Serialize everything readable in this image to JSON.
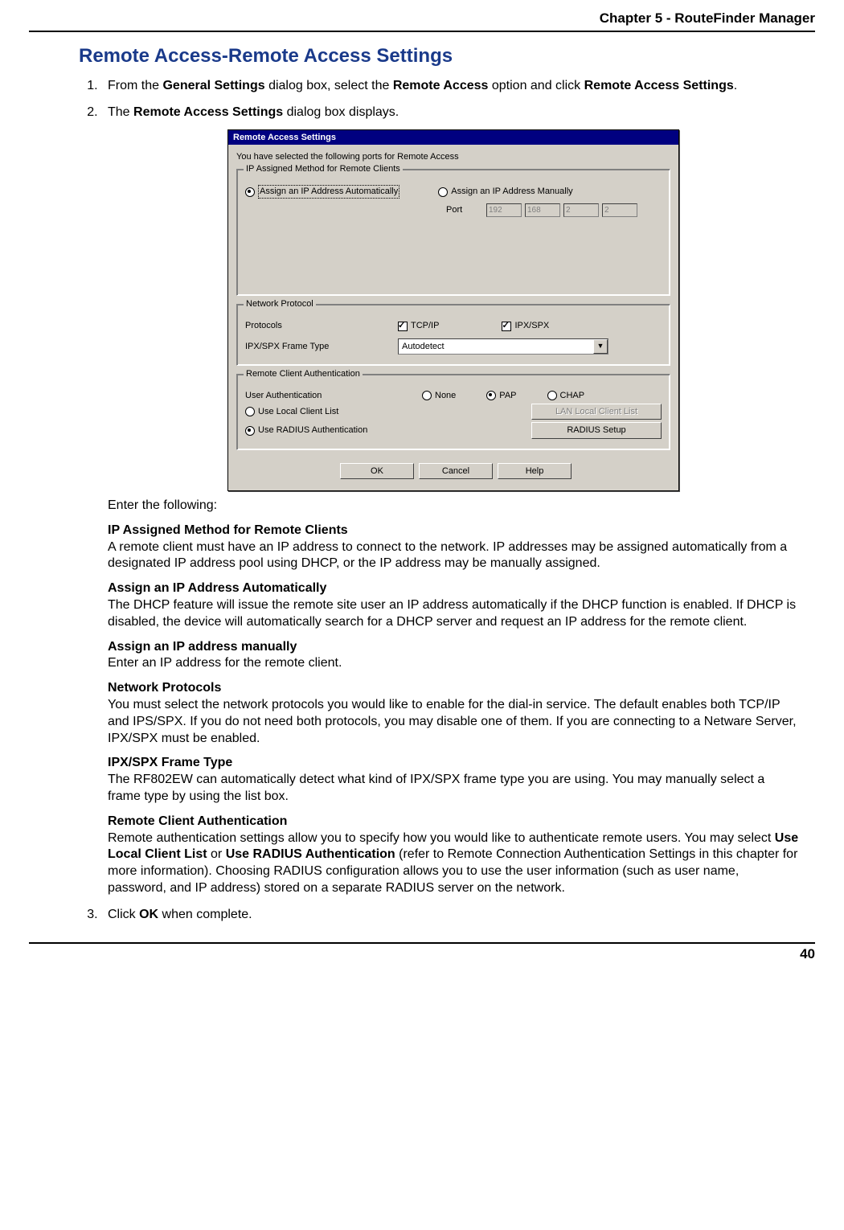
{
  "chapter_header": "Chapter 5 - RouteFinder Manager",
  "page_number": "40",
  "section_title": "Remote Access-Remote Access Settings",
  "steps": {
    "s1_pre": "From the ",
    "s1_b1": "General Settings",
    "s1_mid1": " dialog box, select the ",
    "s1_b2": "Remote Access",
    "s1_mid2": " option and click ",
    "s1_b3": "Remote Access Settings",
    "s1_end": ".",
    "s2_pre": "The ",
    "s2_b1": "Remote Access Settings",
    "s2_end": " dialog box displays.",
    "s2_enter": "Enter the following:",
    "s3_pre": "Click ",
    "s3_b1": "OK",
    "s3_end": " when complete."
  },
  "blocks": {
    "ip_method_title": "IP Assigned Method for Remote Clients",
    "ip_method_body": "A remote client must have an IP address to connect to the network.  IP addresses may be assigned automatically from a designated IP address pool using DHCP, or the IP address may be manually assigned.",
    "auto_title": "Assign an IP Address Automatically",
    "auto_body": "The DHCP feature will issue the remote site user an IP address automatically if the DHCP function is enabled.  If DHCP is disabled, the device will automatically search for a DHCP server and request an IP address for the remote client.",
    "manual_title": "Assign an IP address manually",
    "manual_body": "Enter an IP address for the remote client.",
    "netproto_title": "Network Protocols",
    "netproto_body": "You must select the network protocols you would like to enable for the dial-in service.  The default enables both TCP/IP and IPS/SPX.  If you do not need both protocols, you may disable one of them.  If you are connecting to a Netware Server, IPX/SPX must be enabled.",
    "frame_title": "IPX/SPX Frame Type",
    "frame_body": "The RF802EW can automatically detect what kind of IPX/SPX frame type you are using.  You may manually select a frame type by using the list box.",
    "auth_title": "Remote Client Authentication",
    "auth_body_pre": "Remote authentication settings allow you to specify how you would like to authenticate remote users.  You may select ",
    "auth_b1": "Use Local Client List",
    "auth_mid": " or ",
    "auth_b2": "Use RADIUS Authentication",
    "auth_body_post": " (refer to Remote Connection Authentication Settings in this chapter for more information).  Choosing RADIUS configuration allows you to use the user information (such as user name, password, and IP address) stored on a separate RADIUS server on the network."
  },
  "dialog": {
    "title": "Remote Access Settings",
    "info": "You have selected the following ports for Remote Access",
    "gb_ip": "IP Assigned Method for Remote Clients",
    "opt_auto": "Assign an IP Address Automatically",
    "opt_manual": "Assign an IP Address Manually",
    "port_label": "Port",
    "ip": [
      "192",
      "168",
      "2",
      "2"
    ],
    "gb_net": "Network Protocol",
    "protocols_label": "Protocols",
    "tcpip": "TCP/IP",
    "ipxspx": "IPX/SPX",
    "frametype_label": "IPX/SPX Frame Type",
    "frametype_value": "Autodetect",
    "gb_auth": "Remote Client Authentication",
    "userauth_label": "User Authentication",
    "none": "None",
    "pap": "PAP",
    "chap": "CHAP",
    "use_local": "Use Local Client List",
    "use_radius": "Use RADIUS Authentication",
    "btn_lan": "LAN Local Client List",
    "btn_radius": "RADIUS Setup",
    "btn_ok": "OK",
    "btn_cancel": "Cancel",
    "btn_help": "Help"
  }
}
